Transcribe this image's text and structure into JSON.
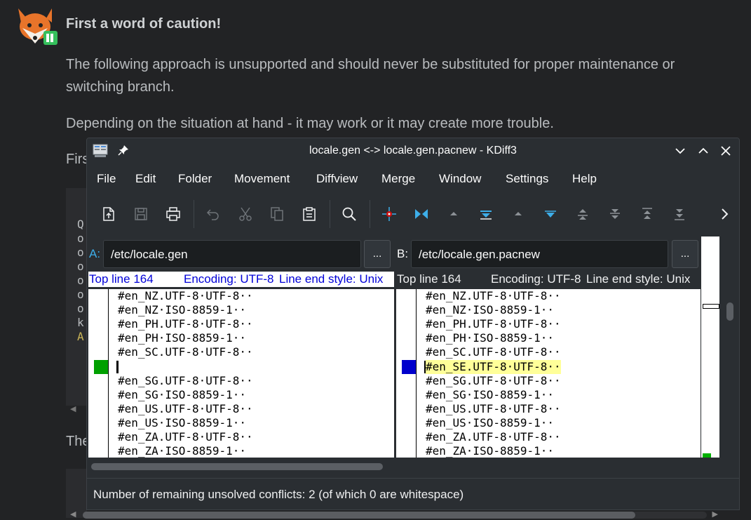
{
  "post": {
    "title": "First a word of caution!",
    "p1": "The following approach is unsupported and should never be substituted for proper maintenance or switching branch.",
    "p2": "Depending on the situation at hand - it may work or it may create more trouble.",
    "partial_first": "Firs",
    "partial_the": "The",
    "code_fragments": [
      "Q",
      "o",
      "o",
      "o",
      "o",
      "o",
      "o",
      "k",
      "A"
    ]
  },
  "window": {
    "title": "locale.gen <-> locale.gen.pacnew - KDiff3",
    "menu": [
      "File",
      "Edit",
      "Folder",
      "Movement",
      "Diffview",
      "Merge",
      "Window",
      "Settings",
      "Help"
    ],
    "toolbar_icons": [
      "new-file-icon",
      "save-icon",
      "print-icon",
      "undo-icon",
      "cut-icon",
      "copy-icon",
      "paste-icon",
      "search-icon",
      "go-current-delta-icon",
      "go-top-icon",
      "go-prev-delta-icon",
      "go-next-delta-icon",
      "go-prev-conflict-icon",
      "go-next-conflict-icon",
      "go-prev-unsolved-icon",
      "go-next-unsolved-icon",
      "go-first-icon",
      "go-last-icon",
      "more-icon"
    ]
  },
  "pane_a": {
    "label": "A:",
    "path": "/etc/locale.gen",
    "browse": "...",
    "top_line": "Top line 164",
    "encoding": "Encoding: UTF-8",
    "line_end": "Line end style: Unix",
    "lines": [
      "#en_NZ.UTF-8·UTF-8··",
      "#en_NZ·ISO-8859-1··",
      "#en_PH.UTF-8·UTF-8··",
      "#en_PH·ISO-8859-1··",
      "#en_SC.UTF-8·UTF-8··",
      "",
      "#en_SG.UTF-8·UTF-8··",
      "#en_SG·ISO-8859-1··",
      "#en_US.UTF-8·UTF-8··",
      "#en_US·ISO-8859-1··",
      "#en_ZA.UTF-8·UTF-8··",
      "#en_ZA·ISO-8859-1··"
    ]
  },
  "pane_b": {
    "label": "B:",
    "path": "/etc/locale.gen.pacnew",
    "browse": "...",
    "top_line": "Top line 164",
    "encoding": "Encoding: UTF-8",
    "line_end": "Line end style: Unix",
    "lines": [
      "#en_NZ.UTF-8·UTF-8··",
      "#en_NZ·ISO-8859-1··",
      "#en_PH.UTF-8·UTF-8··",
      "#en_PH·ISO-8859-1··",
      "#en_SC.UTF-8·UTF-8··",
      "#en_SE.UTF-8·UTF-8··",
      "#en_SG.UTF-8·UTF-8··",
      "#en_SG·ISO-8859-1··",
      "#en_US.UTF-8·UTF-8··",
      "#en_US·ISO-8859-1··",
      "#en_ZA.UTF-8·UTF-8··",
      "#en_ZA·ISO-8859-1··"
    ]
  },
  "status": "Number of remaining unsolved conflicts: 2 (of which 0 are whitespace)",
  "colors": {
    "marker_a": "#00a000",
    "marker_b": "#0000cc",
    "highlight": "#ffff99",
    "info_text_a": "#0000d8"
  }
}
